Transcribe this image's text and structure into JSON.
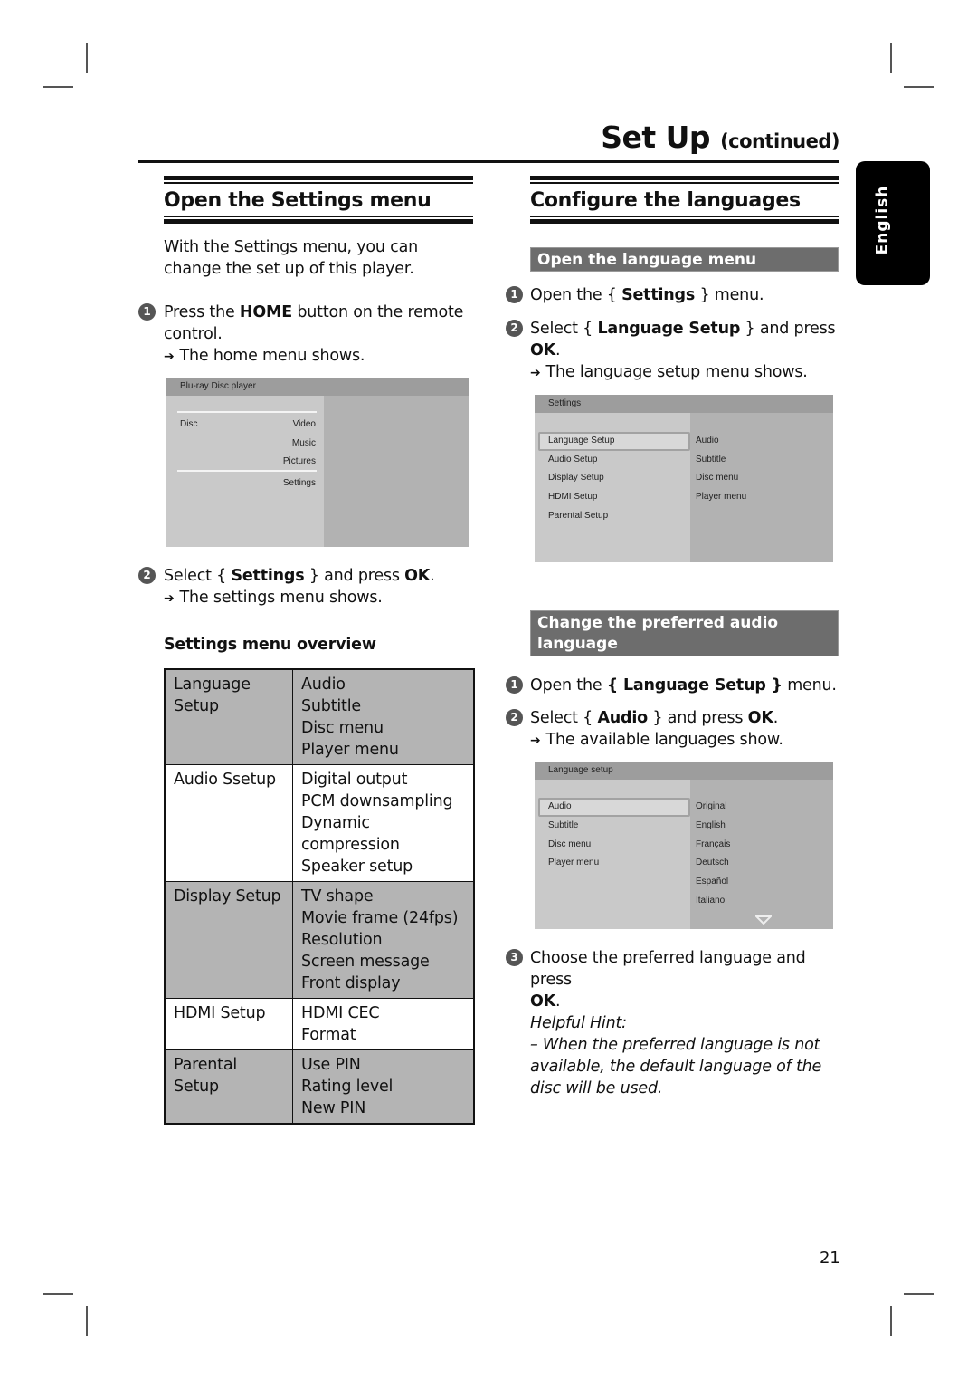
{
  "header": {
    "title": "Set Up",
    "title_suffix": "(continued)"
  },
  "side_tab": {
    "label": "English"
  },
  "left": {
    "section_title": "Open the Settings menu",
    "intro": "With the Settings menu, you can change the set up of this player.",
    "step1": {
      "num": "1",
      "pre": "Press the ",
      "bold": "HOME",
      "post": " button on the remote control.",
      "result": "The home menu shows."
    },
    "home_screen": {
      "title": "Blu-ray Disc player",
      "left_item": "Disc",
      "items": [
        "Video",
        "Music",
        "Pictures",
        "Settings"
      ]
    },
    "step2": {
      "num": "2",
      "pre": "Select { ",
      "bold": "Settings",
      "mid": " } and press ",
      "bold2": "OK",
      "post": ".",
      "result": "The settings menu shows."
    },
    "overview_title": "Settings menu overview",
    "overview": [
      {
        "menu": "Language Setup",
        "items": [
          "Audio",
          "Subtitle",
          "Disc menu",
          "Player menu"
        ]
      },
      {
        "menu": "Audio Ssetup",
        "items": [
          "Digital output",
          "PCM downsampling",
          "Dynamic compression",
          "Speaker setup"
        ]
      },
      {
        "menu": "Display Setup",
        "items": [
          "TV shape",
          "Movie frame (24fps)",
          "Resolution",
          "Screen message",
          "Front display"
        ]
      },
      {
        "menu": "HDMI Setup",
        "items": [
          "HDMI CEC",
          "Format"
        ]
      },
      {
        "menu": "Parental Setup",
        "items": [
          "Use PIN",
          "Rating level",
          "New PIN"
        ]
      }
    ]
  },
  "right": {
    "section_title": "Configure the languages",
    "sub1": "Open the language menu",
    "s1_step1": {
      "num": "1",
      "pre": "Open the { ",
      "bold": "Settings",
      "post": " } menu."
    },
    "s1_step2": {
      "num": "2",
      "pre": "Select { ",
      "bold": "Language Setup",
      "post": " } and press ",
      "bold2": "OK",
      "post2": ".",
      "result": "The language setup menu shows."
    },
    "settings_screen": {
      "title": "Settings",
      "left_items": [
        "Language Setup",
        "Audio Setup",
        "Display Setup",
        "HDMI Setup",
        "Parental Setup"
      ],
      "right_items": [
        "Audio",
        "Subtitle",
        "Disc menu",
        "Player menu"
      ],
      "selected": "Language Setup"
    },
    "sub2": "Change the preferred audio language",
    "s2_step1": {
      "num": "1",
      "pre": "Open the ",
      "bold": "{ Language Setup }",
      "post": " menu."
    },
    "s2_step2": {
      "num": "2",
      "pre": "Select { ",
      "bold": "Audio",
      "post": " } and press ",
      "bold2": "OK",
      "post2": ".",
      "result": "The available languages show."
    },
    "lang_screen": {
      "title": "Language setup",
      "left_items": [
        "Audio",
        "Subtitle",
        "Disc menu",
        "Player menu"
      ],
      "right_items": [
        "Original",
        "English",
        "Français",
        "Deutsch",
        "Español",
        "Italiano"
      ],
      "selected": "Audio",
      "scroll_icon": "triangle-down"
    },
    "s2_step3": {
      "num": "3",
      "pre": "Choose the preferred language and press ",
      "bold": "OK",
      "post": "."
    },
    "hint_title": "Helpful Hint:",
    "hint_text": "– When the preferred language is not available, the default language of the disc will be used."
  },
  "footer": {
    "page_number": "21"
  }
}
